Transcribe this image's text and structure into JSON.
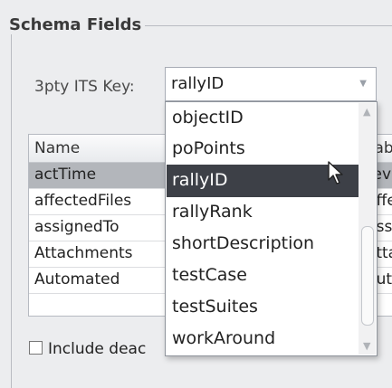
{
  "group": {
    "title": "Schema Fields"
  },
  "key": {
    "label": "3pty ITS Key:",
    "value": "rallyID"
  },
  "table": {
    "headers": [
      "Name",
      "Lab"
    ],
    "rows": [
      {
        "name": "actTime",
        "label": "Tev"
      },
      {
        "name": "affectedFiles",
        "label": "Affe"
      },
      {
        "name": "assignedTo",
        "label": "Ass"
      },
      {
        "name": "Attachments",
        "label": "Atta"
      },
      {
        "name": "Automated",
        "label": "Aut"
      }
    ]
  },
  "checkbox": {
    "label": "Include deac"
  },
  "dropdown": {
    "options": [
      "objectID",
      "poPoints",
      "rallyID",
      "rallyRank",
      "shortDescription",
      "testCase",
      "testSuites",
      "workAround"
    ],
    "selected": "rallyID"
  }
}
